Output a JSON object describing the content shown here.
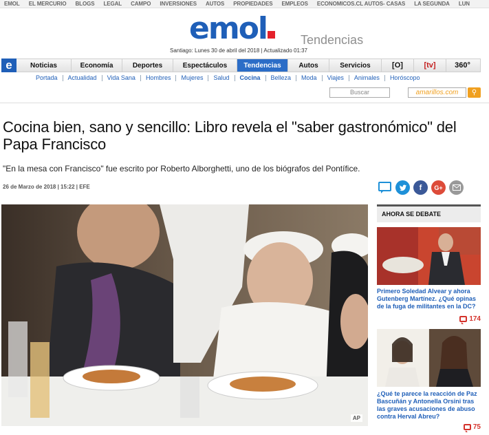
{
  "network_links": [
    "EMOL",
    "EL MERCURIO",
    "BLOGS",
    "LEGAL",
    "CAMPO",
    "INVERSIONES",
    "AUTOS",
    "PROPIEDADES",
    "EMPLEOS",
    "ECONOMICOS.CL AUTOS- CASAS",
    "LA SEGUNDA",
    "LUN"
  ],
  "header": {
    "logo": "emol",
    "section": "Tendencias",
    "dateline": "Santiago: Lunes 30 de abril del 2018 | Actualizado 01:37"
  },
  "main_nav": {
    "home_icon": "e",
    "items": [
      "Noticias",
      "Economía",
      "Deportes",
      "Espectáculos",
      "Tendencias",
      "Autos",
      "Servicios"
    ],
    "active": "Tendencias",
    "extra": [
      "[O]",
      "[tv]",
      "360°"
    ]
  },
  "sub_nav": [
    "Portada",
    "Actualidad",
    "Vida Sana",
    "Hombres",
    "Mujeres",
    "Salud",
    "Cocina",
    "Belleza",
    "Moda",
    "Viajes",
    "Animales",
    "Horóscopo"
  ],
  "search": {
    "placeholder": "Buscar",
    "amarillos": "amarillos.com"
  },
  "article": {
    "headline": "Cocina bien, sano y sencillo: Libro revela el \"saber gastronómico\" del Papa Francisco",
    "subhead": "\"En la mesa con Francisco\" fue escrito por Roberto Alborghetti, uno de los biógrafos del Pontífice.",
    "meta": "26 de Marzo de 2018 | 15:22 | EFE",
    "photo_credit": "AP"
  },
  "sidebar": {
    "title": "AHORA SE DEBATE",
    "items": [
      {
        "text": "Primero Soledad Alvear y ahora Gutenberg Martínez. ¿Qué opinas de la fuga de militantes en la DC?",
        "comments": "174"
      },
      {
        "text": "¿Qué te parece la reacción de Paz Bascuñán y Antonella Orsini tras las graves acusaciones de abuso contra Herval Abreu?",
        "comments": "75"
      }
    ]
  },
  "colors": {
    "brand_blue": "#1f5fb8",
    "brand_red": "#e4212b",
    "active_tab": "#2b6dc7",
    "comment_red": "#d4322b"
  }
}
